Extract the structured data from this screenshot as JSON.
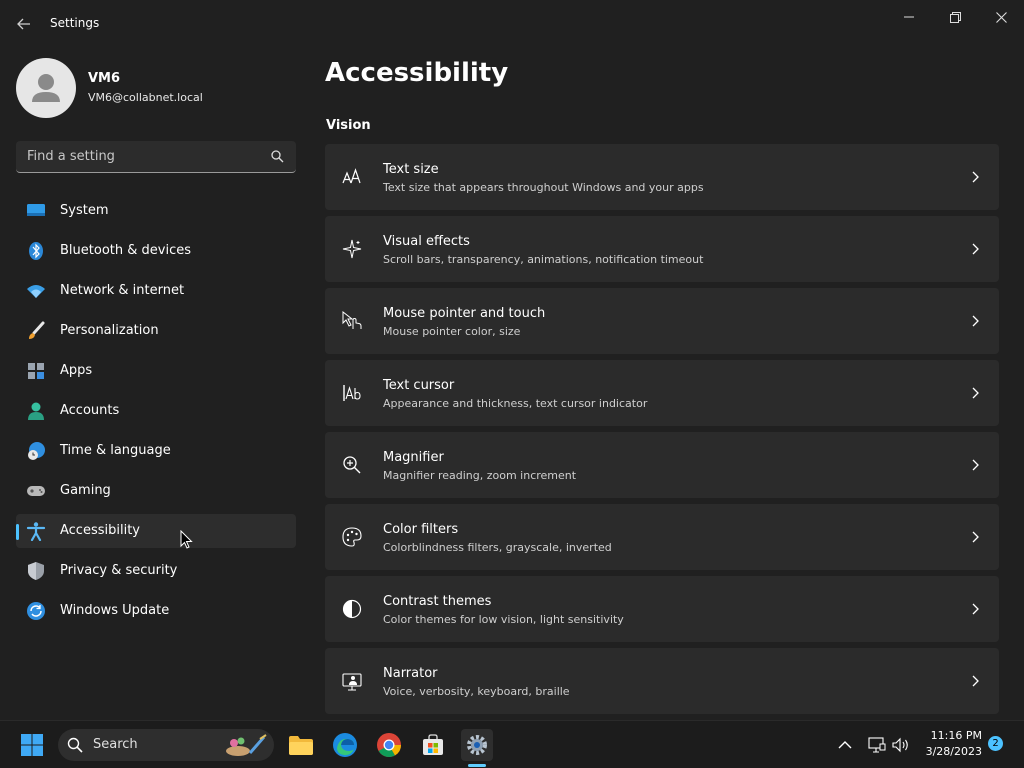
{
  "window": {
    "title": "Settings"
  },
  "user": {
    "name": "VM6",
    "email": "VM6@collabnet.local"
  },
  "search": {
    "placeholder": "Find a setting"
  },
  "sidebar": {
    "items": [
      {
        "label": "System",
        "icon": "system-icon"
      },
      {
        "label": "Bluetooth & devices",
        "icon": "bluetooth-icon"
      },
      {
        "label": "Network & internet",
        "icon": "wifi-icon"
      },
      {
        "label": "Personalization",
        "icon": "brush-icon"
      },
      {
        "label": "Apps",
        "icon": "apps-icon"
      },
      {
        "label": "Accounts",
        "icon": "accounts-icon"
      },
      {
        "label": "Time & language",
        "icon": "globe-clock-icon"
      },
      {
        "label": "Gaming",
        "icon": "controller-icon"
      },
      {
        "label": "Accessibility",
        "icon": "accessibility-icon",
        "selected": true
      },
      {
        "label": "Privacy & security",
        "icon": "shield-icon"
      },
      {
        "label": "Windows Update",
        "icon": "update-icon"
      }
    ]
  },
  "main": {
    "title": "Accessibility",
    "section": "Vision",
    "items": [
      {
        "title": "Text size",
        "description": "Text size that appears throughout Windows and your apps",
        "icon": "text-size-icon"
      },
      {
        "title": "Visual effects",
        "description": "Scroll bars, transparency, animations, notification timeout",
        "icon": "sparkle-icon"
      },
      {
        "title": "Mouse pointer and touch",
        "description": "Mouse pointer color, size",
        "icon": "pointer-touch-icon"
      },
      {
        "title": "Text cursor",
        "description": "Appearance and thickness, text cursor indicator",
        "icon": "text-cursor-icon"
      },
      {
        "title": "Magnifier",
        "description": "Magnifier reading, zoom increment",
        "icon": "zoom-in-icon"
      },
      {
        "title": "Color filters",
        "description": "Colorblindness filters, grayscale, inverted",
        "icon": "palette-icon"
      },
      {
        "title": "Contrast themes",
        "description": "Color themes for low vision, light sensitivity",
        "icon": "contrast-icon"
      },
      {
        "title": "Narrator",
        "description": "Voice, verbosity, keyboard, braille",
        "icon": "narrator-icon"
      }
    ]
  },
  "taskbar": {
    "search_label": "Search",
    "time": "11:16 PM",
    "date": "3/28/2023",
    "notification_count": "2"
  },
  "colors": {
    "background": "#202020",
    "card": "#2b2b2b",
    "taskbar": "#1c1c1c"
  }
}
